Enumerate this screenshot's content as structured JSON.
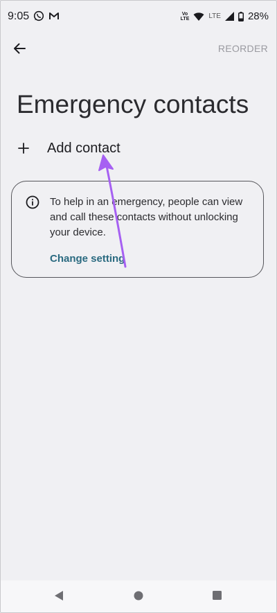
{
  "status_bar": {
    "time": "9:05",
    "left_icons": [
      "whatsapp-icon",
      "gmail-icon"
    ],
    "volte_top": "Vo",
    "volte_bottom": "LTE",
    "network_label": "LTE",
    "battery_percent": "28%"
  },
  "app_bar": {
    "back_icon": "arrow-back-icon",
    "reorder_label": "REORDER"
  },
  "title": "Emergency contacts",
  "add_contact": {
    "icon": "plus-icon",
    "label": "Add contact"
  },
  "info_card": {
    "icon": "info-icon",
    "text": "To help in an emergency, people can view and call these contacts without unlocking your device.",
    "action_label": "Change setting"
  },
  "annotation": {
    "color": "#a660f2"
  },
  "colors": {
    "background": "#f0f0f3",
    "accent_link": "#2a6a80",
    "muted": "#9a9aa0"
  },
  "nav_bar": {
    "icons": [
      "nav-back-icon",
      "nav-home-icon",
      "nav-recents-icon"
    ]
  }
}
